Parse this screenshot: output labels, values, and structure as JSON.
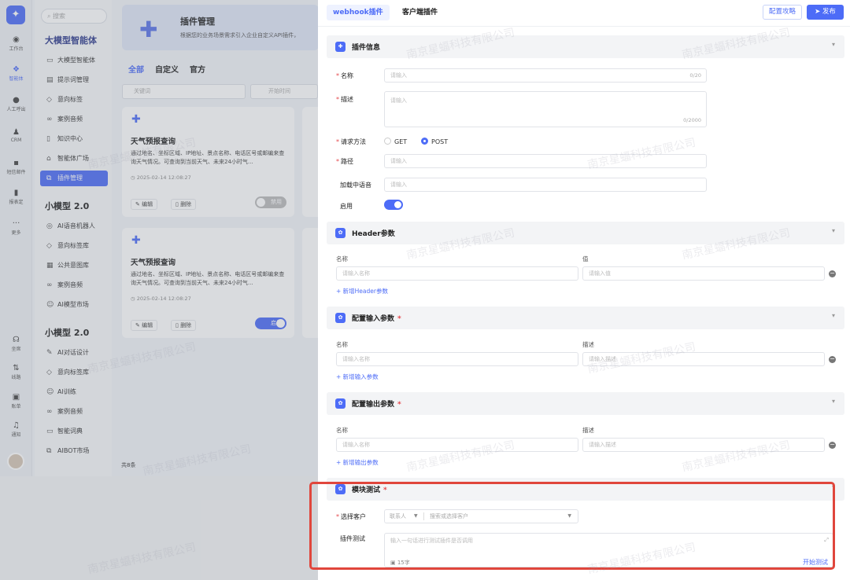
{
  "rail": {
    "items": [
      {
        "label": "工作台",
        "icon": "dashboard-icon"
      },
      {
        "label": "智能体",
        "icon": "agent-icon"
      },
      {
        "label": "人工呼出",
        "icon": "call-icon"
      },
      {
        "label": "CRM",
        "icon": "crm-icon"
      },
      {
        "label": "短信邮件",
        "icon": "sms-icon"
      },
      {
        "label": "报表定",
        "icon": "report-icon"
      },
      {
        "label": "更多",
        "icon": "more-icon"
      },
      {
        "label": "坐席",
        "icon": "seat-icon"
      },
      {
        "label": "线路",
        "icon": "line-icon"
      },
      {
        "label": "账单",
        "icon": "bill-icon"
      },
      {
        "label": "通知",
        "icon": "bell-icon"
      }
    ]
  },
  "sidebar": {
    "search_placeholder": "搜索",
    "groups": [
      {
        "title": "大模型智能体",
        "items": [
          "大模型智能体",
          "提示词管理",
          "意向标签",
          "案例音频",
          "知识中心",
          "智能体广场",
          "插件管理"
        ]
      },
      {
        "title": "小模型 2.0",
        "items": [
          "AI语音机器人",
          "意向标签库",
          "公共意图库",
          "案例音频",
          "AI模型市场"
        ]
      },
      {
        "title": "小模型 2.0",
        "items": [
          "AI对话设计",
          "意向标签库",
          "AI训练",
          "案例音频",
          "智能词典",
          "AIBOT市场"
        ]
      }
    ]
  },
  "main": {
    "banner_title": "插件管理",
    "banner_desc": "根据您的业务场景需求引入企业自定义API插件，",
    "tabs": [
      "全部",
      "自定义",
      "官方"
    ],
    "keyword_placeholder": "关键词",
    "time_placeholder": "开始时间",
    "cards": [
      {
        "name": "天气预报查询",
        "desc": "通过地名、坐标区域、IP地址、景点名称、电话区号或邮编来查询天气情况。可查询到当前天气、未来24小时气...",
        "time": "2025-02-14 12:08:27",
        "edit": "编辑",
        "delete": "删除",
        "toggle": "禁用",
        "enabled": false
      },
      {
        "name": "天气预报查询",
        "desc": "通过地名、坐标区域、IP地址、景点名称、电话区号或邮编来查询天气情况。可查询到当前天气、未来24小时气...",
        "time": "2025-02-14 12:08:27",
        "edit": "编辑",
        "delete": "删除",
        "toggle": "启用",
        "enabled": true
      }
    ],
    "total": "共8条"
  },
  "panel": {
    "tabs": [
      "webhook插件",
      "客户端插件"
    ],
    "guide_button": "配置攻略",
    "publish_button": "发布",
    "info": {
      "title": "插件信息",
      "name_label": "名称",
      "name_placeholder": "请输入",
      "name_count": "0/20",
      "desc_label": "描述",
      "desc_placeholder": "请输入",
      "desc_count": "0/2000",
      "method_label": "请求方法",
      "method_get": "GET",
      "method_post": "POST",
      "path_label": "路径",
      "path_placeholder": "请输入",
      "loading_label": "加载中语音",
      "loading_placeholder": "请输入",
      "enable_label": "启用",
      "enabled": true
    },
    "header": {
      "title": "Header参数",
      "col_name": "名称",
      "col_value": "值",
      "name_placeholder": "请输入名称",
      "value_placeholder": "请输入值",
      "add": "+ 新增Header参数"
    },
    "input_params": {
      "title": "配置输入参数",
      "col_name": "名称",
      "col_desc": "描述",
      "name_placeholder": "请输入名称",
      "desc_placeholder": "请输入描述",
      "add": "+ 新增输入参数"
    },
    "output_params": {
      "title": "配置输出参数",
      "col_name": "名称",
      "col_desc": "描述",
      "name_placeholder": "请输入名称",
      "desc_placeholder": "请输入描述",
      "add": "+ 新增输出参数"
    },
    "test": {
      "title": "模块测试",
      "customer_label": "选择客户",
      "contact_placeholder": "联系人",
      "customer_placeholder": "搜索或选择客户",
      "plugin_test_label": "插件测试",
      "test_placeholder": "输入一句话进行测试插件是否调用",
      "image_count": "15字",
      "start_button": "开始测试"
    }
  },
  "watermark": "南京星蝠科技有限公司",
  "colors": {
    "accent": "#4d6cf7",
    "highlight": "#e0463c",
    "required": "#e5484d"
  }
}
